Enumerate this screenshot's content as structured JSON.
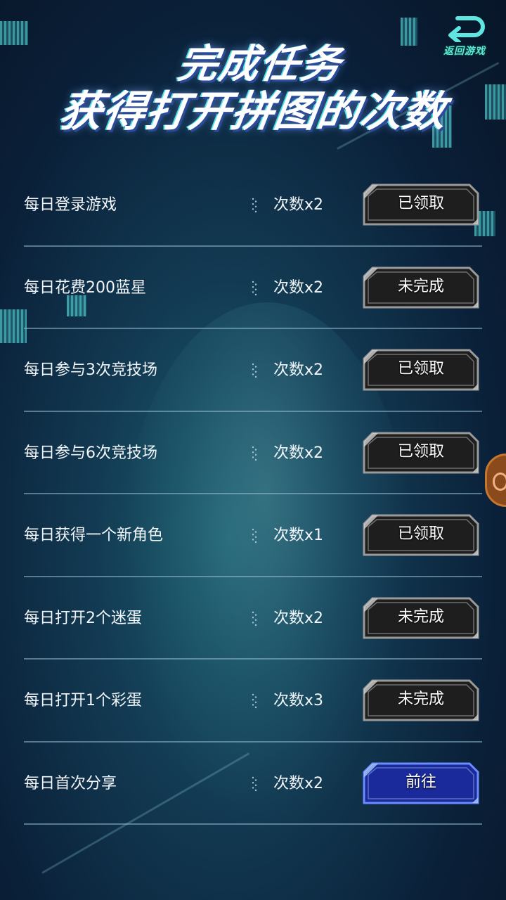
{
  "header": {
    "back_label": "返回游戏",
    "title_line1": "完成任务",
    "title_line2": "获得打开拼图的次数"
  },
  "tasks": [
    {
      "name": "每日登录游戏",
      "count": "次数x2",
      "button": "已领取",
      "state": "claimed"
    },
    {
      "name": "每日花费200蓝星",
      "count": "次数x2",
      "button": "未完成",
      "state": "incomplete"
    },
    {
      "name": "每日参与3次竞技场",
      "count": "次数x2",
      "button": "已领取",
      "state": "claimed"
    },
    {
      "name": "每日参与6次竞技场",
      "count": "次数x2",
      "button": "已领取",
      "state": "claimed"
    },
    {
      "name": "每日获得一个新角色",
      "count": "次数x1",
      "button": "已领取",
      "state": "claimed"
    },
    {
      "name": "每日打开2个迷蛋",
      "count": "次数x2",
      "button": "未完成",
      "state": "incomplete"
    },
    {
      "name": "每日打开1个彩蛋",
      "count": "次数x3",
      "button": "未完成",
      "state": "incomplete"
    },
    {
      "name": "每日首次分享",
      "count": "次数x2",
      "button": "前往",
      "state": "go"
    }
  ],
  "colors": {
    "accent": "#5fe6e0",
    "button_dark": "#1e1e1e",
    "button_go": "#1a2a9a",
    "divider": "#96bed2"
  },
  "icons": {
    "back": "return-arrow-icon",
    "side_tab": "heart-icon"
  }
}
